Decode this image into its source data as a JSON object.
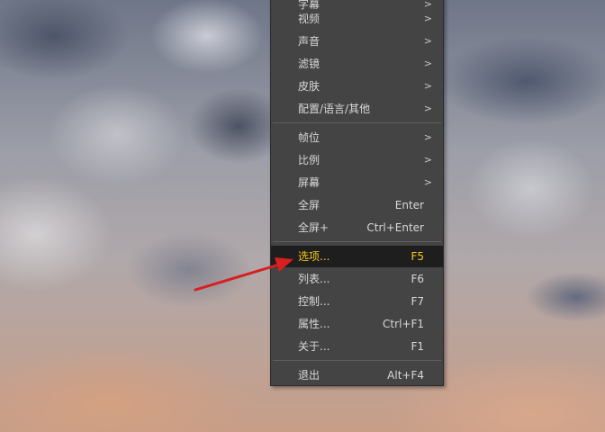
{
  "menu": {
    "items": [
      {
        "label": "字幕",
        "shortcut": "",
        "submenu": true
      },
      {
        "label": "视频",
        "shortcut": "",
        "submenu": true
      },
      {
        "label": "声音",
        "shortcut": "",
        "submenu": true
      },
      {
        "label": "滤镜",
        "shortcut": "",
        "submenu": true
      },
      {
        "label": "皮肤",
        "shortcut": "",
        "submenu": true
      },
      {
        "label": "配置/语言/其他",
        "shortcut": "",
        "submenu": true
      },
      {
        "label": "帧位",
        "shortcut": "",
        "submenu": true
      },
      {
        "label": "比例",
        "shortcut": "",
        "submenu": true
      },
      {
        "label": "屏幕",
        "shortcut": "",
        "submenu": true
      },
      {
        "label": "全屏",
        "shortcut": "Enter",
        "submenu": false
      },
      {
        "label": "全屏+",
        "shortcut": "Ctrl+Enter",
        "submenu": false
      },
      {
        "label": "选项...",
        "shortcut": "F5",
        "submenu": false,
        "selected": true
      },
      {
        "label": "列表...",
        "shortcut": "F6",
        "submenu": false
      },
      {
        "label": "控制...",
        "shortcut": "F7",
        "submenu": false
      },
      {
        "label": "属性...",
        "shortcut": "Ctrl+F1",
        "submenu": false
      },
      {
        "label": "关于...",
        "shortcut": "F1",
        "submenu": false
      },
      {
        "label": "退出",
        "shortcut": "Alt+F4",
        "submenu": false
      }
    ],
    "submenu_arrow": ">"
  },
  "colors": {
    "menu_bg": "#444444",
    "menu_text": "#d8d8d8",
    "selected_bg": "#1e1e1e",
    "selected_text": "#f3c71a",
    "annotation_arrow": "#d81e1e"
  },
  "icons": {
    "annotation": "red-arrow-pointer"
  }
}
